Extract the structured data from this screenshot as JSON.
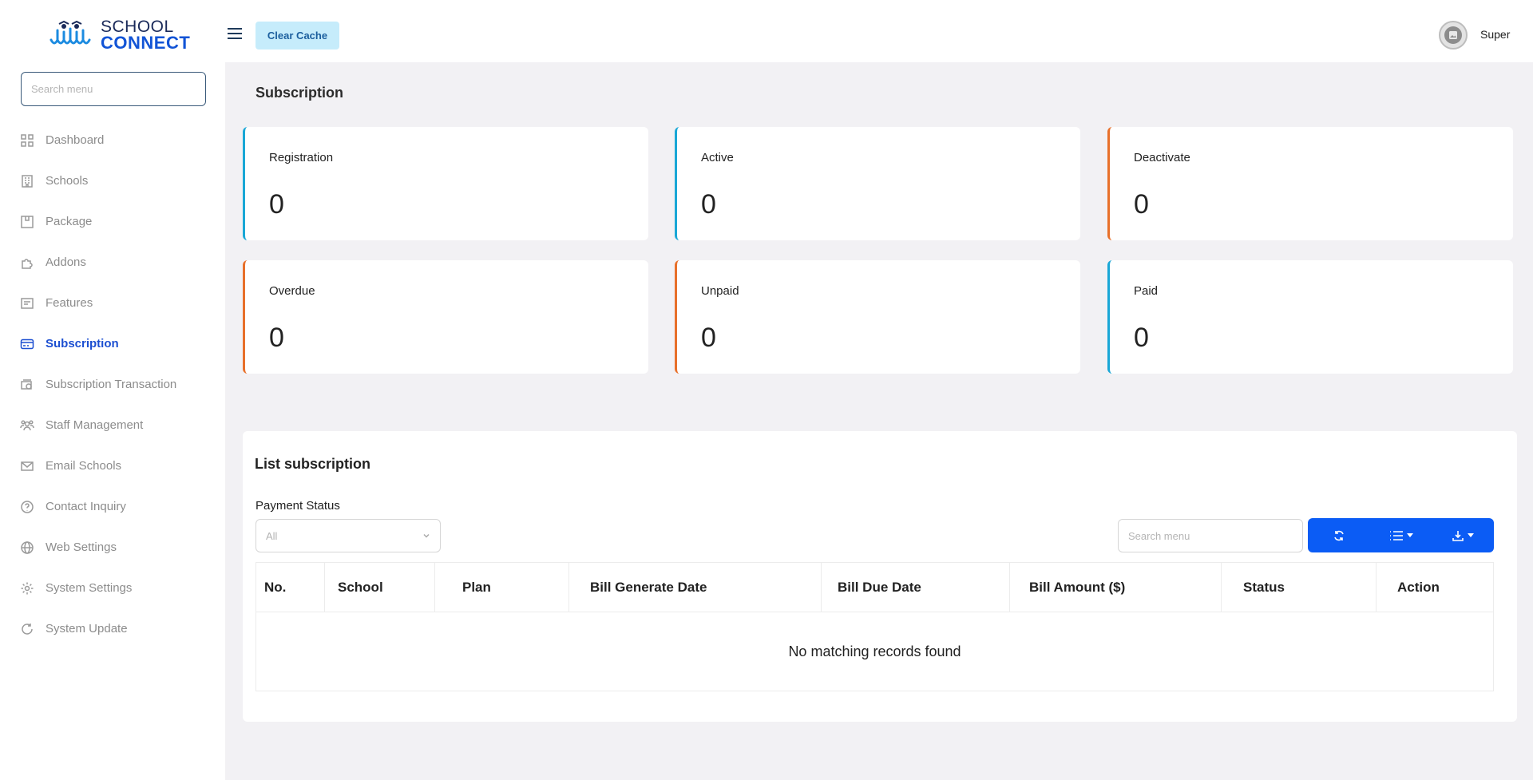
{
  "brand": {
    "line1": "SCHOOL",
    "line2": "CONNECT"
  },
  "sidebar": {
    "search_placeholder": "Search menu",
    "items": [
      {
        "label": "Dashboard",
        "icon": "grid-icon"
      },
      {
        "label": "Schools",
        "icon": "building-icon"
      },
      {
        "label": "Package",
        "icon": "package-icon"
      },
      {
        "label": "Addons",
        "icon": "puzzle-icon"
      },
      {
        "label": "Features",
        "icon": "features-icon"
      },
      {
        "label": "Subscription",
        "icon": "card-icon",
        "active": true
      },
      {
        "label": "Subscription Transaction",
        "icon": "money-icon"
      },
      {
        "label": "Staff Management",
        "icon": "users-icon"
      },
      {
        "label": "Email Schools",
        "icon": "mail-icon"
      },
      {
        "label": "Contact Inquiry",
        "icon": "help-icon"
      },
      {
        "label": "Web Settings",
        "icon": "globe-icon"
      },
      {
        "label": "System Settings",
        "icon": "gear-icon"
      },
      {
        "label": "System Update",
        "icon": "update-icon"
      }
    ]
  },
  "topbar": {
    "clear_cache": "Clear Cache",
    "user_name": "Super"
  },
  "page": {
    "title": "Subscription"
  },
  "cards": [
    {
      "label": "Registration",
      "value": "0",
      "accent": "#19a7d6"
    },
    {
      "label": "Active",
      "value": "0",
      "accent": "#19a7d6"
    },
    {
      "label": "Deactivate",
      "value": "0",
      "accent": "#e8702a"
    },
    {
      "label": "Overdue",
      "value": "0",
      "accent": "#e8702a"
    },
    {
      "label": "Unpaid",
      "value": "0",
      "accent": "#e8702a"
    },
    {
      "label": "Paid",
      "value": "0",
      "accent": "#19a7d6"
    }
  ],
  "list": {
    "title": "List subscription",
    "filter_label": "Payment Status",
    "filter_value": "All",
    "search_placeholder": "Search menu",
    "columns": [
      "No.",
      "School",
      "Plan",
      "Bill Generate Date",
      "Bill Due Date",
      "Bill Amount ($)",
      "Status",
      "Action"
    ],
    "empty_message": "No matching records found"
  },
  "colors": {
    "primary": "#0b5cf5",
    "active_menu": "#1c4fd1",
    "cyan_accent": "#19a7d6",
    "orange_accent": "#e8702a"
  }
}
